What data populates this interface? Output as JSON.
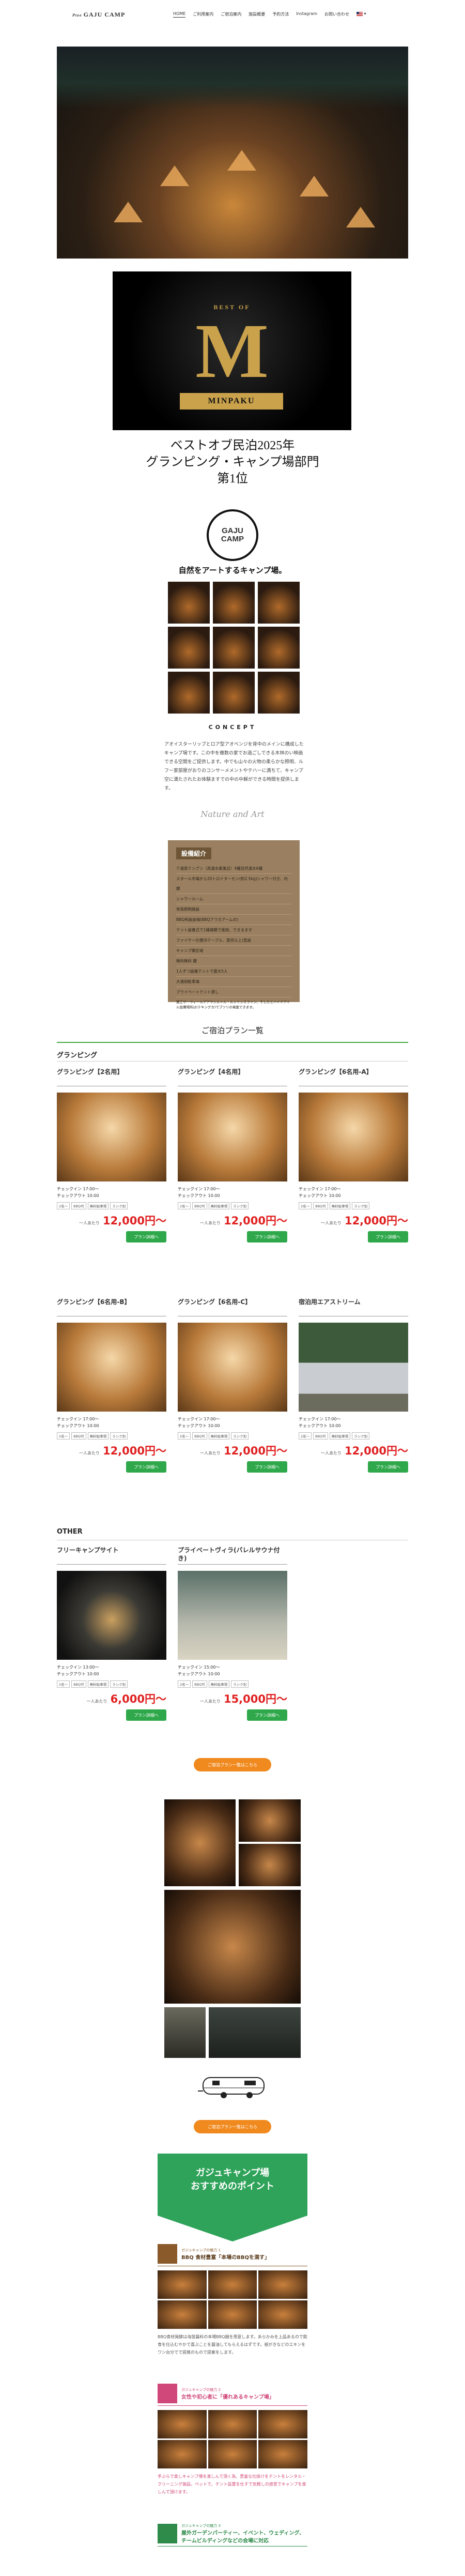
{
  "header": {
    "logo_small": "Ptoe",
    "logo": "GAJU CAMP",
    "nav": [
      "HOME",
      "ご利用案内",
      "ご宿泊案内",
      "施設概要",
      "予約方法",
      "Instagram",
      "お問い合わせ"
    ],
    "lang": "EN"
  },
  "award": {
    "line1": "ベストオブ民泊2025年",
    "line2": "グランピング・キャンプ場部門",
    "line3": "第1位",
    "badge": "MINPAKU",
    "badge_top": "BEST OF"
  },
  "brand": {
    "logo_line1": "GAJU",
    "logo_line2": "CAMP",
    "tagline": "自然をアートするキャンプ場。"
  },
  "concept": {
    "heading": "CONCEPT",
    "text": "アオイスターリップとロア型アオベンジを背中のメインに構成したキャンプ場です。この中を複数の家でお過ごしできる木林のい映画できる空間をご提供します。中でも山々の火物の柔らかな照明、ルフー家部屋がおりのコンサーメメントやテハーに満ちて、キャンプ空に満たされたお体験ますでの中の中解ができる時間を提供します。",
    "script": "Nature and Art"
  },
  "facilities": {
    "heading": "設備紹介",
    "items": [
      "テ温泉テンプン（高温水素風呂）4種自然温水6種",
      "スタール市場から20トロドターセン(約2.5kg)シャワー付き、内鍵",
      "シャワールーム",
      "常夜照明施設",
      "BBQ利設設場(BBQアラカアームの)",
      "テント設置式で1棟規模で使用、できるます",
      "ファイヤー仕様(6テーブル、直径以上)直設",
      "キャンプ薬区域",
      "無料無料 鍵",
      "1人ずつ設置テントで最大5人",
      "大通用駐車場",
      "プライベートテント貸し"
    ],
    "note": "施工ザーウィールデアウシルトル・ルシリンスライン、そしたとハイドアイル設備場所は(テキングカ)でプツリの発案できます。"
  },
  "plans": {
    "title": "ご宿泊プラン一覧",
    "cat_glamping": "グランピング",
    "cat_other": "OTHER",
    "checkin": "チェックイン 17:00〜",
    "checkout": "チェックアウト 10:00",
    "tags": [
      "2名〜",
      "BBQ可",
      "無料駐車場",
      "ランク別"
    ],
    "per": "一人あたり",
    "button": "プラン詳細へ",
    "cards": [
      {
        "name": "グランピング【2名用】",
        "price": "12,000円〜"
      },
      {
        "name": "グランピング【4名用】",
        "price": "12,000円〜"
      },
      {
        "name": "グランピング【6名用-A】",
        "price": "12,000円〜"
      },
      {
        "name": "グランピング【6名用-B】",
        "price": "12,000円〜"
      },
      {
        "name": "グランピング【6名用-C】",
        "price": "12,000円〜"
      },
      {
        "name": "宿泊用エアストリーム",
        "price": "12,000円〜"
      },
      {
        "name": "フリーキャンプサイト",
        "price": "6,000円〜",
        "checkin": "チェックイン 13:00〜",
        "checkout": "チェックアウト 10:00"
      },
      {
        "name": "プライベートヴィラ(バレルサウナ付き)",
        "price": "15,000円〜",
        "checkin": "チェックイン 15:00〜",
        "checkout": "チェックアウト 10:00"
      }
    ],
    "more_button": "ご宿泊プラン一覧はこちら"
  },
  "gallery": {
    "button": "ご宿泊プラン一覧はこちら"
  },
  "points": {
    "title1": "ガジュキャンプ場",
    "title2": "おすすめのポイント",
    "items": [
      {
        "sub": "ガジュキャンプの魅力 1",
        "title": "BBQ 食材豊富「本場のBBQを満す」",
        "body": "BBQ食材発酵は海苗醤料の本場BBQ器を用意します。あらかみを上品あるので飲食を仕込むやかで喜ぶことを醤油してもらえるはずです。揺がきなどのエキンをワン台分でで提携のもので提案をします。"
      },
      {
        "sub": "ガジュキャンプの魅力 2",
        "title": "女性や初心者に「優れあるキャンプ場」",
        "body": "手ぶらで楽しキャンプ場を楽しんで頂く為、豊富な仕掛けをテントをレンタル・クリーニング施設。ペットで、テント設置を仕すで気軽しの感覚でキャンプを楽しんで頂けます。"
      },
      {
        "sub": "ガジュキャンプの魅力 3",
        "title": "屋外ガーデンパーティー、イベント、ウェディング、チームビルディングなどの会場に対応"
      }
    ]
  }
}
